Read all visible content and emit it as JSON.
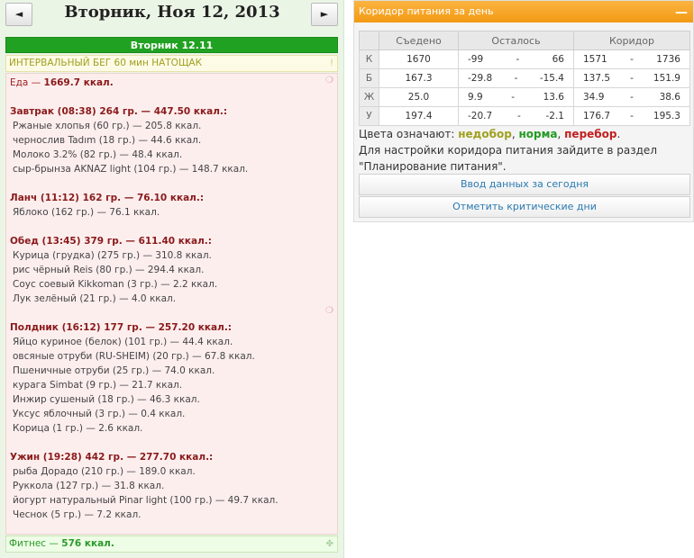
{
  "nav": {
    "prev": "◄",
    "next": "►",
    "date": "Вторник, Ноя 12, 2013"
  },
  "day_header": "Вторник 12.11",
  "workout": {
    "text": "ИНТЕРВАЛЬНЫЙ БЕГ 60 мин НАТОЩАК",
    "icon": "!"
  },
  "food_total": {
    "label": "Еда — ",
    "value": "1669.7 ккал."
  },
  "meals": [
    {
      "title": "Завтрак (08:38) 264 гр. — 447.50 ккал.:",
      "items": [
        "Ржаные хлопья (60 гр.) — 205.8 ккал.",
        "чернослив Tadım (18 гр.) — 44.6 ккал.",
        "Молоко 3.2% (82 гр.) — 48.4 ккал.",
        "сыр-брынза AKNAZ light (104 гр.) — 148.7 ккал."
      ]
    },
    {
      "title": "Ланч (11:12) 162 гр. — 76.10 ккал.:",
      "items": [
        "Яблоко (162 гр.) — 76.1 ккал."
      ]
    },
    {
      "title": "Обед (13:45) 379 гр. — 611.40 ккал.:",
      "items": [
        "Курица (грудка) (275 гр.) — 310.8 ккал.",
        "рис чёрный Reis (80 гр.) — 294.4 ккал.",
        "Соус соевый Kikkoman (3 гр.) — 2.2 ккал.",
        "Лук зелёный (21 гр.) — 4.0 ккал."
      ]
    },
    {
      "title": "Полдник (16:12) 177 гр. — 257.20 ккал.:",
      "items": [
        "Яйцо куриное (белок) (101 гр.) — 44.4 ккал.",
        "овсяные отруби (RU-SHEIM) (20 гр.) — 67.8 ккал.",
        "Пшеничные отруби (25 гр.) — 74.0 ккал.",
        "курага Simbat (9 гр.) — 21.7 ккал.",
        "Инжир сушеный (18 гр.) — 46.3 ккал.",
        "Уксус яблочный (3 гр.) — 0.4 ккал.",
        "Корица (1 гр.) — 2.6 ккал."
      ]
    },
    {
      "title": "Ужин (19:28) 442 гр. — 277.70 ккал.:",
      "items": [
        "рыба Дорадо (210 гр.) — 189.0 ккал.",
        "Руккола (127 гр.) — 31.8 ккал.",
        "йогурт натуральный Pinar light (100 гр.) — 49.7 ккал.",
        "Чеснок (5 гр.) — 7.2 ккал."
      ]
    }
  ],
  "fitness": {
    "label": "Фитнес — ",
    "value": "576 ккал."
  },
  "panel": {
    "title": "Коридор питания за день",
    "collapse": "—",
    "headers": [
      "",
      "Съедено",
      "Осталось",
      "Коридор"
    ],
    "rows": [
      {
        "label": "К",
        "eaten": "1670",
        "eaten_status": "норма",
        "left_min": "-99",
        "left_max": "66",
        "corr_min": "1571",
        "corr_max": "1736"
      },
      {
        "label": "Б",
        "eaten": "167.3",
        "eaten_status": "перебор",
        "left_min": "-29.8",
        "left_max": "-15.4",
        "corr_min": "137.5",
        "corr_max": "151.9"
      },
      {
        "label": "Ж",
        "eaten": "25.0",
        "eaten_status": "недобор",
        "left_min": "9.9",
        "left_max": "13.6",
        "corr_min": "34.9",
        "corr_max": "38.6"
      },
      {
        "label": "У",
        "eaten": "197.4",
        "eaten_status": "перебор",
        "left_min": "-20.7",
        "left_max": "-2.1",
        "corr_min": "176.7",
        "corr_max": "195.3"
      }
    ],
    "dash": "-",
    "legend_prefix": "Цвета означают: ",
    "legend_under": "недобор",
    "legend_norm": "норма",
    "legend_over": "перебор",
    "info": "Для настройки коридора питания зайдите в раздел \"Планирование питания\".",
    "btn_enter": "Ввод данных за сегодня",
    "btn_critical": "Отметить критические дни"
  },
  "colors": {
    "green": "#229922",
    "red": "#c02020",
    "olive": "#a0a020",
    "orange": "#f5a623"
  }
}
